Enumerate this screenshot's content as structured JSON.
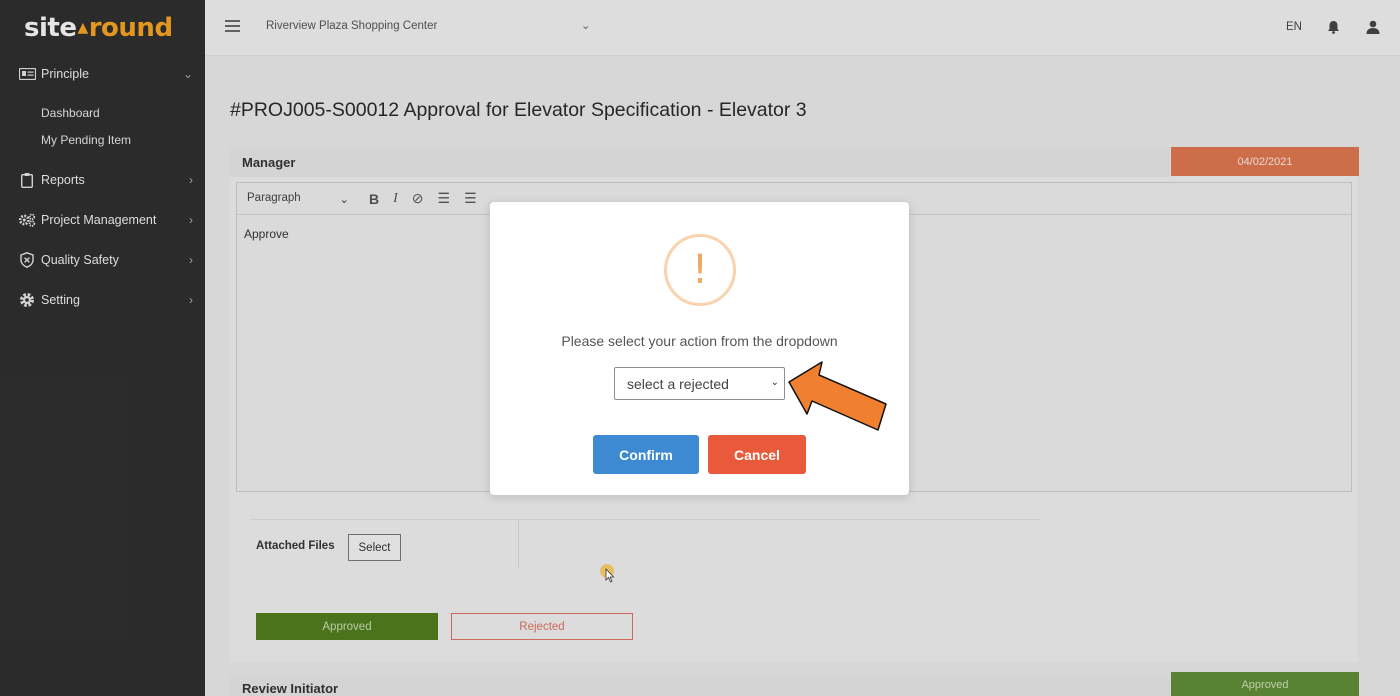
{
  "logo": {
    "part1": "site",
    "part2": "round"
  },
  "sidebar": {
    "items": [
      {
        "label": "Principle",
        "icon": "id-card-icon"
      },
      {
        "label": "Reports",
        "icon": "clipboard-icon"
      },
      {
        "label": "Project Management",
        "icon": "gears-icon"
      },
      {
        "label": "Quality Safety",
        "icon": "shield-icon"
      },
      {
        "label": "Setting",
        "icon": "gear-icon"
      }
    ],
    "sub_items": [
      "Dashboard",
      "My Pending Item"
    ]
  },
  "header": {
    "project": "Riverview Plaza Shopping Center",
    "language": "EN"
  },
  "main": {
    "title": "#PROJ005-S00012 Approval for Elevator Specification - Elevator 3",
    "section": "Manager",
    "date": "04/02/2021",
    "editor": {
      "format": "Paragraph",
      "content": "Approve"
    },
    "attached_label": "Attached Files",
    "select_label": "Select",
    "approved_label": "Approved",
    "rejected_label": "Rejected",
    "section2": "Review Initiator",
    "section2_status": "Approved"
  },
  "modal": {
    "icon": "exclamation-icon",
    "message": "Please select your action from the dropdown",
    "select_value": "select a rejected",
    "confirm_label": "Confirm",
    "cancel_label": "Cancel"
  },
  "colors": {
    "accent_orange": "#f0a020",
    "confirm": "#3d8ad3",
    "cancel": "#e85a3b",
    "approved": "#4e7a1e",
    "date_badge": "#d9734e",
    "arrow": "#f08030"
  }
}
